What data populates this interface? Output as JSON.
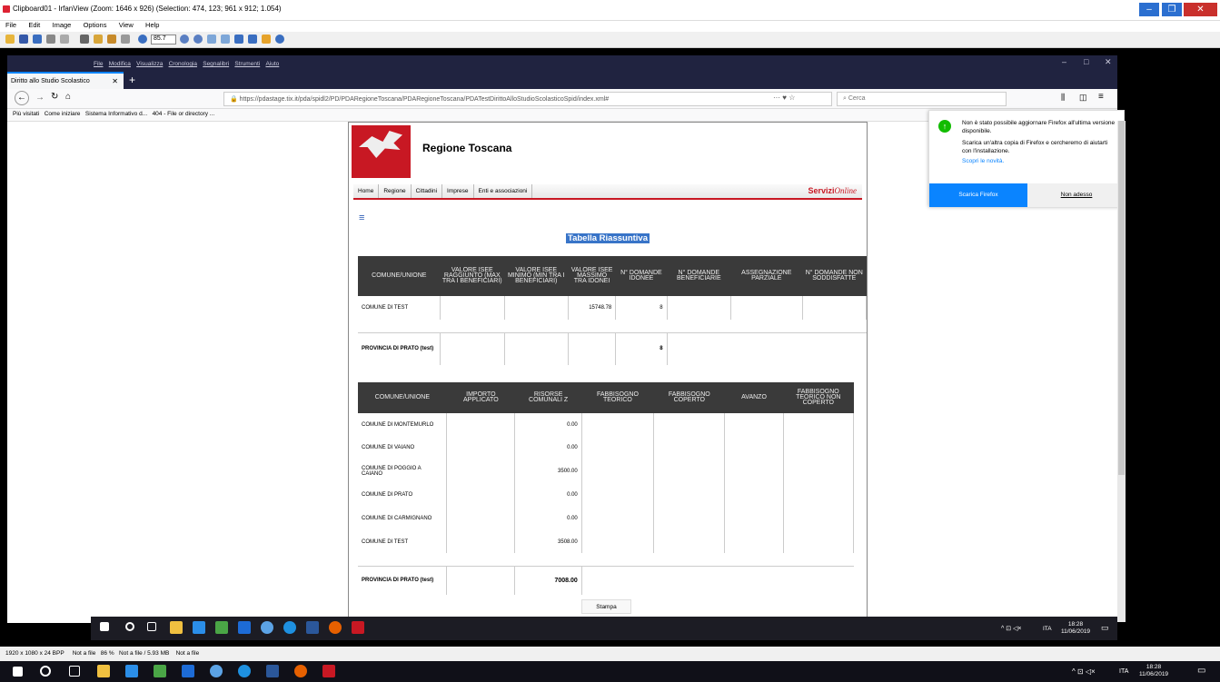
{
  "irfanview": {
    "title": "Clipboard01 - IrfanView (Zoom: 1646 x 926) (Selection: 474, 123; 961 x 912; 1.054)",
    "menu": [
      "File",
      "Edit",
      "Image",
      "Options",
      "View",
      "Help"
    ],
    "zoom": "85.7",
    "status": [
      "1920 x 1080 x 24 BPP",
      "Not a file",
      "86 %",
      "Not a file / 5.93 MB",
      "Not a file"
    ]
  },
  "firefox": {
    "menu": [
      "File",
      "Modifica",
      "Visualizza",
      "Cronologia",
      "Segnalibri",
      "Strumenti",
      "Aiuto"
    ],
    "tab_title": "Diritto allo Studio Scolastico",
    "url": "https://pdastage.tix.it/pda/spidl2/PD/PDARegioneToscana/PDARegioneToscana/PDATestDirittoAlloStudioScolasticoSpid/index.xml#",
    "search_placeholder": "Cerca",
    "bookmarks": [
      "Più visitati",
      "Come iniziare",
      "Sistema Informativo d...",
      "404 - File or directory ..."
    ]
  },
  "site": {
    "name": "Regione Toscana",
    "nav": [
      "Home",
      "Regione",
      "Cittadini",
      "Imprese",
      "Enti e associazioni"
    ],
    "servizi": "Servizi",
    "online": "Online",
    "table_title": "Tabella Riassuntiva",
    "print": "Stampa"
  },
  "table1": {
    "headers": [
      "COMUNE/UNIONE",
      "VALORE ISEE RAGGIUNTO (MAX TRA I BENEFICIARI)",
      "VALORE ISEE MINIMO (MIN TRA I BENEFICIARI)",
      "VALORE ISEE MASSIMO TRA IDONEI",
      "N° DOMANDE IDONEE",
      "N° DOMANDE BENEFICIARIE",
      "ASSEGNAZIONE PARZIALE",
      "N° DOMANDE NON SODDISFATTE"
    ],
    "rows": [
      [
        "COMUNE DI TEST",
        "",
        "",
        "15748.78",
        "8",
        "",
        "",
        ""
      ]
    ],
    "total_label": "PROVINCIA DI PRATO (test)",
    "total_value": "8"
  },
  "table2": {
    "headers": [
      "COMUNE/UNIONE",
      "IMPORTO APPLICATO",
      "RISORSE COMUNALI Z",
      "FABBISOGNO TEORICO",
      "FABBISOGNO COPERTO",
      "AVANZO",
      "FABBISOGNO TEORICO NON COPERTO"
    ],
    "rows": [
      [
        "COMUNE DI MONTEMURLO",
        "",
        "0.00"
      ],
      [
        "COMUNE DI VAIANO",
        "",
        "0.00"
      ],
      [
        "COMUNE DI POGGIO A CAIANO",
        "",
        "3500.00"
      ],
      [
        "COMUNE DI PRATO",
        "",
        "0.00"
      ],
      [
        "COMUNE DI CARMIGNANO",
        "",
        "0.00"
      ],
      [
        "COMUNE DI TEST",
        "",
        "3508.00"
      ]
    ],
    "total_label": "PROVINCIA DI PRATO (test)",
    "total_value": "7008.00"
  },
  "popup": {
    "line1": "Non è stato possibile aggiornare Firefox all'ultima versione disponibile.",
    "line2": "Scarica un'altra copia di Firefox e cercheremo di aiutarti con l'installazione.",
    "link": "Scopri le novità.",
    "btn_primary": "Scarica Firefox",
    "btn_secondary": "Non adesso"
  },
  "taskbar": {
    "lang": "ITA",
    "time": "18:28",
    "date": "11/06/2019"
  },
  "colors": {
    "accent": "#0a84ff",
    "brand_red": "#c81823",
    "header_dark": "#3a3a3a"
  }
}
